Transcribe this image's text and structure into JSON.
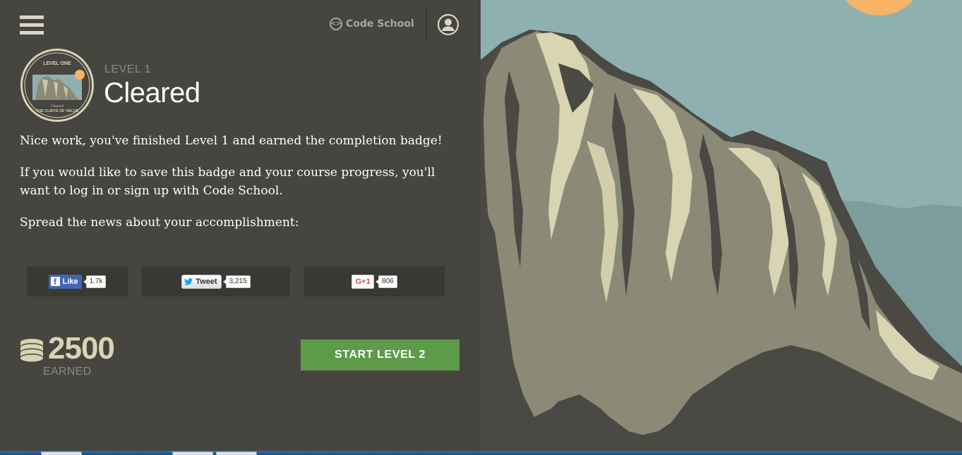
{
  "header": {
    "menu_icon": "hamburger-menu-icon",
    "brand_name": "Code School",
    "brand_icon": "code-brackets-icon",
    "account_icon": "user-account-icon"
  },
  "badge": {
    "top_text": "LEVEL ONE",
    "bottom_small": "Cleared",
    "bottom_text": "THE CLIFFS OF VALUE"
  },
  "level": {
    "label": "LEVEL 1",
    "status": "Cleared"
  },
  "messages": {
    "p1": "Nice work, you've finished Level 1 and earned the completion badge!",
    "p2": "If you would like to save this badge and your course progress, you'll want to log in or sign up with Code School.",
    "p3": "Spread the news about your accomplishment:"
  },
  "share": {
    "facebook": {
      "label": "Like",
      "count": "1.7k"
    },
    "twitter": {
      "label": "Tweet",
      "count": "3,215"
    },
    "google": {
      "label": "G+1",
      "count": "806"
    }
  },
  "points": {
    "value": "2500",
    "label": "EARNED",
    "icon": "coins-stack-icon"
  },
  "cta": {
    "label": "START LEVEL 2"
  },
  "colors": {
    "panel_bg": "#464540",
    "share_bg": "#393934",
    "accent_green": "#5e9b49",
    "points_gold": "#d9d4b1",
    "sky": "#8fb0b0",
    "sun": "#f5b466"
  }
}
